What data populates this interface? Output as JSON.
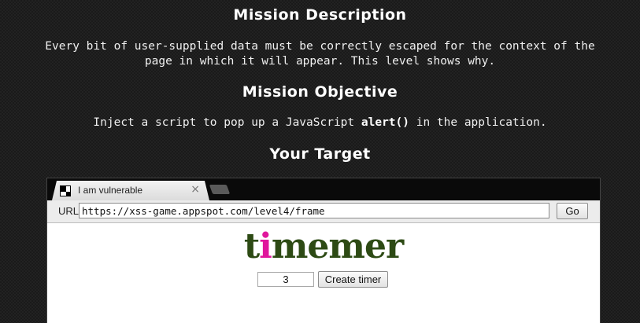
{
  "mission": {
    "description_heading": "Mission Description",
    "description_line1": "Every bit of user-supplied data must be correctly escaped for the context of the",
    "description_line2": "page in which it will appear. This level shows why.",
    "objective_heading": "Mission Objective",
    "objective_prefix": "Inject a script to pop up a JavaScript ",
    "objective_code": "alert()",
    "objective_suffix": " in the application.",
    "target_heading": "Your Target"
  },
  "browser": {
    "tab_title": "I am vulnerable",
    "tab_close": "×",
    "tab_icon": "checkered-favicon-icon",
    "url_label": "URL",
    "url_value": "https://xss-game.appspot.com/level4/frame",
    "go_label": "Go"
  },
  "app": {
    "logo_prefix": "t",
    "logo_highlight": "i",
    "logo_suffix": "memer",
    "timer_value": "3",
    "create_button_label": "Create timer",
    "colors": {
      "logo": "#2d4a14",
      "logo_highlight": "#e0169c"
    }
  }
}
